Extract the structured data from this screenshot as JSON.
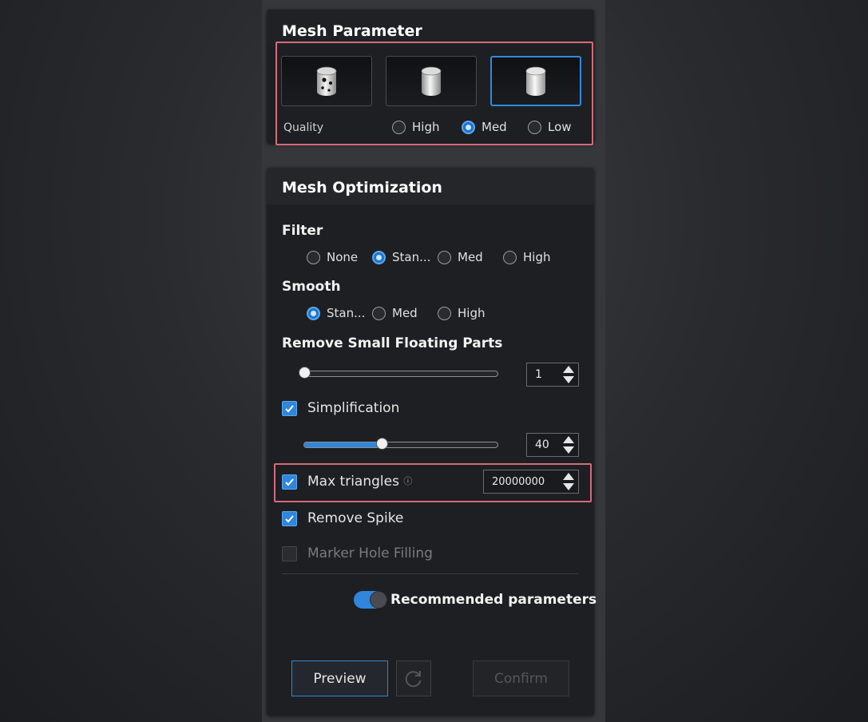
{
  "mesh_parameter": {
    "title": "Mesh Parameter",
    "quality_label": "Quality",
    "quality_options": [
      "High",
      "Med",
      "Low"
    ],
    "quality_selected": "Med",
    "quality_icons": [
      "cylinder-holes-icon",
      "cylinder-medium-icon",
      "cylinder-smooth-icon"
    ]
  },
  "mesh_optimization": {
    "title": "Mesh Optimization",
    "filter": {
      "label": "Filter",
      "options": [
        "None",
        "Stan...",
        "Med",
        "High"
      ],
      "selected": "Stan..."
    },
    "smooth": {
      "label": "Smooth",
      "options": [
        "Stan...",
        "Med",
        "High"
      ],
      "selected": "Stan..."
    },
    "remove_small_floating_parts": {
      "label": "Remove Small Floating Parts",
      "value": "1",
      "slider_fraction": 0.0
    },
    "simplification": {
      "label": "Simplification",
      "checked": true,
      "value": "40",
      "slider_fraction": 0.4
    },
    "max_triangles": {
      "label": "Max triangles",
      "checked": true,
      "value": "20000000",
      "info_icon": "ⓘ"
    },
    "remove_spike": {
      "label": "Remove Spike",
      "checked": true
    },
    "marker_hole_filling": {
      "label": "Marker Hole Filling",
      "checked": false
    },
    "recommended": {
      "label": "Recommended parameters",
      "on": true
    }
  },
  "buttons": {
    "preview": "Preview",
    "confirm": "Confirm"
  },
  "colors": {
    "accent": "#2f86db",
    "highlight": "#d46a7e"
  }
}
